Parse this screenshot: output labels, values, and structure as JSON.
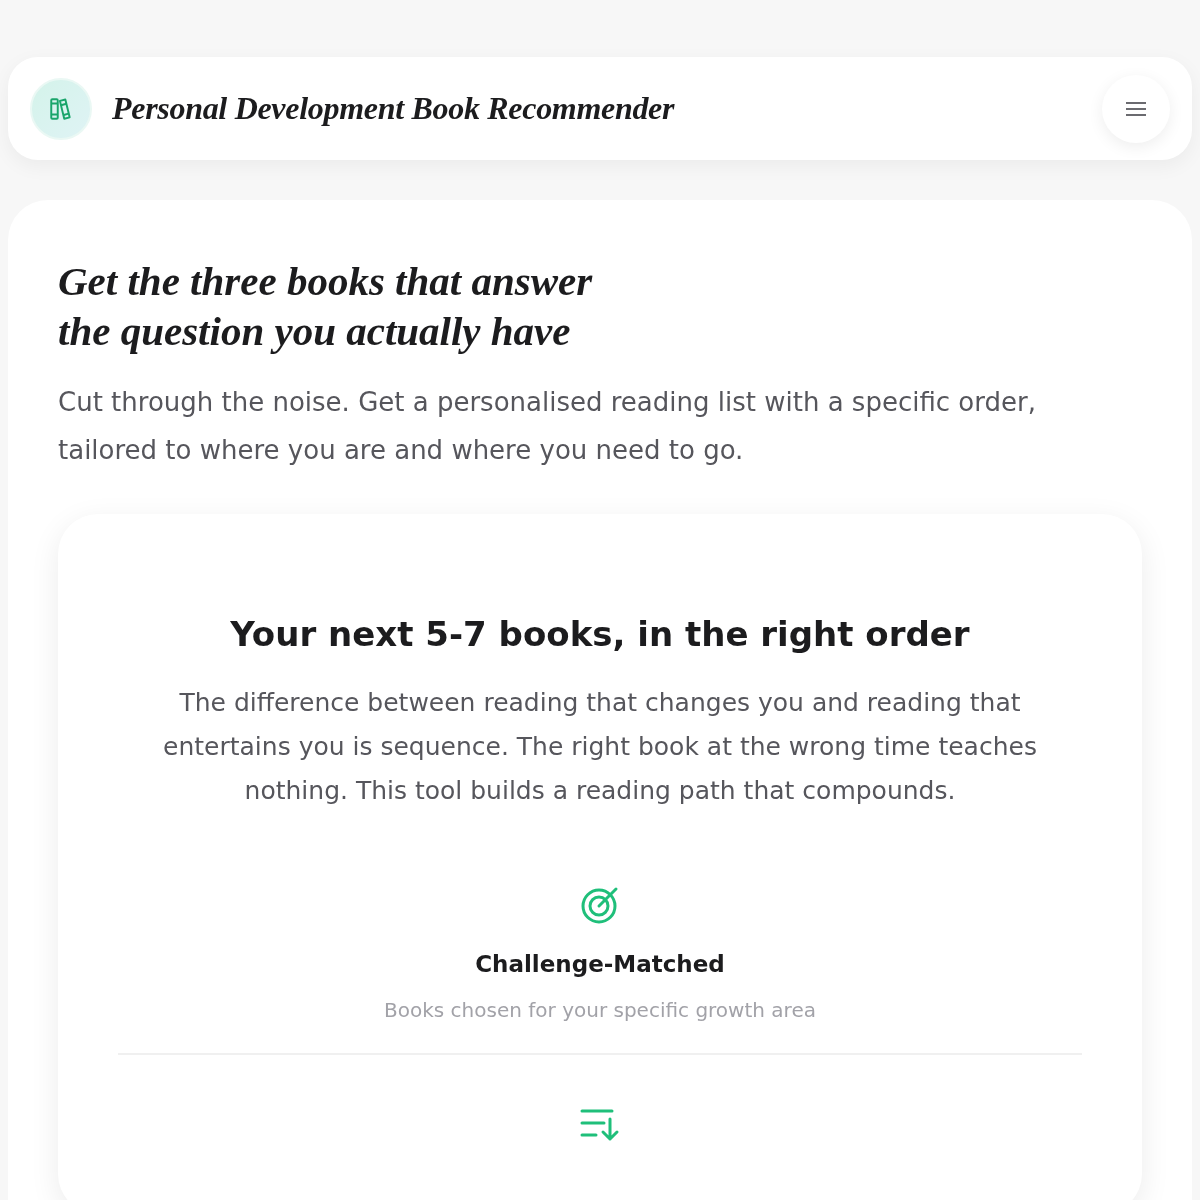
{
  "header": {
    "title": "Personal Development Book Recommender"
  },
  "hero": {
    "heading_lines": [
      "Get the three books that answer",
      "the question you actually have"
    ],
    "subtitle": "Cut through the noise. Get a personalised reading list with a specific order, tailored to where you are and where you need to go."
  },
  "intro_card": {
    "title": "Your next 5-7 books, in the right order",
    "text": "The difference between reading that changes you and reading that entertains you is sequence. The right book at the wrong time teaches nothing. This tool builds a reading path that compounds.",
    "features": [
      {
        "kind": "target",
        "title": "Challenge-Matched",
        "description": "Books chosen for your specific growth area"
      },
      {
        "kind": "sequence"
      }
    ]
  }
}
